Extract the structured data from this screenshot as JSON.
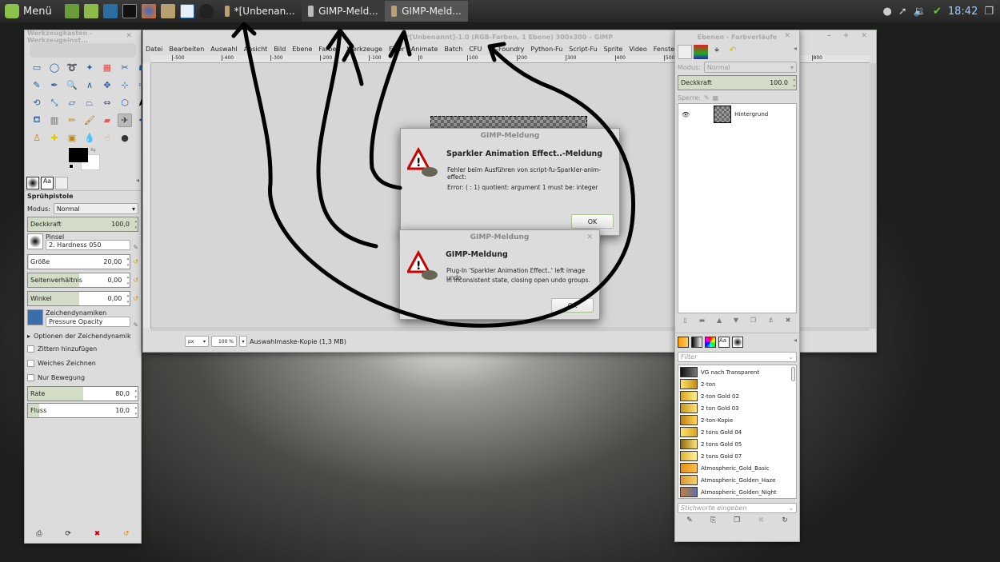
{
  "taskbar": {
    "menu_label": "Menü",
    "launchers": [
      "show-desktop-icon",
      "files-icon",
      "network-icon",
      "terminal-icon",
      "firefox-icon",
      "gimp-icon",
      "writer-icon",
      "tux-icon"
    ],
    "tasks": [
      {
        "label": "*[Unbenan...",
        "active": false
      },
      {
        "label": "GIMP-Meld...",
        "active": false
      },
      {
        "label": "GIMP-Meld...",
        "active": true
      }
    ],
    "clock": "18:42",
    "tray": [
      "user-icon",
      "network-icon",
      "volume-icon",
      "shield-check-icon",
      "windows-icon"
    ]
  },
  "toolbox": {
    "title": "Werkzeugkasten - Werkzeugeinst...",
    "tool_name": "Sprühpistole",
    "mode_label": "Modus:",
    "mode_value": "Normal",
    "opacity": {
      "label": "Deckkraft",
      "value": "100,0",
      "fraction": 1.0
    },
    "brush_label": "Pinsel",
    "brush_value": "2. Hardness 050",
    "size": {
      "label": "Größe",
      "value": "20,00",
      "fraction": 0.01
    },
    "aspect": {
      "label": "Seitenverhältnis",
      "value": "0,00",
      "fraction": 0.5
    },
    "angle": {
      "label": "Winkel",
      "value": "0,00",
      "fraction": 0.5
    },
    "dynamics_label": "Zeichendynamiken",
    "dynamics_value": "Pressure Opacity",
    "dynamics_options": "Optionen der Zeichendynamik",
    "checkboxes": [
      "Zittern hinzufügen",
      "Weiches Zeichnen",
      "Nur Bewegung"
    ],
    "rate": {
      "label": "Rate",
      "value": "80,0",
      "fraction": 0.5
    },
    "flow": {
      "label": "Fluss",
      "value": "10,0",
      "fraction": 0.1
    },
    "fg_color": "#000000",
    "bg_color": "#ffffff"
  },
  "image_window": {
    "title": "*[Unbenannt]-1.0 (RGB-Farben, 1 Ebene) 300x300 – GIMP",
    "menu": [
      "Datei",
      "Bearbeiten",
      "Auswahl",
      "Ansicht",
      "Bild",
      "Ebene",
      "Farben",
      "Werkzeuge",
      "Filter",
      "Animate",
      "Batch",
      "CFU",
      "FX-Foundry",
      "Python-Fu",
      "Script-Fu",
      "Sprite",
      "Video",
      "Fenster",
      "Hilfe"
    ],
    "ruler_labels": [
      "-500",
      "-400",
      "-300",
      "-200",
      "-100",
      "0",
      "100",
      "200",
      "300",
      "400",
      "500",
      "600",
      "700",
      "800"
    ],
    "unit": "px",
    "zoom": "100 %",
    "status": "Auswahlmaske-Kopie (1,3 MB)"
  },
  "dialog1": {
    "title": "GIMP-Meldung",
    "heading": "Sparkler Animation Effect..-Meldung",
    "line1": "Fehler beim Ausführen von script-fu-Sparkler-anim-effect:",
    "line2": "Error: ( : 1) quotient: argument 1 must be: integer",
    "ok": "OK"
  },
  "dialog2": {
    "title": "GIMP-Meldung",
    "heading": "GIMP-Meldung",
    "line1": "Plug-In 'Sparkler Animation Effect..' left image undo",
    "line2": "in inconsistent state, closing open undo groups.",
    "ok": "OK"
  },
  "layers_dock": {
    "title": "Ebenen - Farbverläufe",
    "mode_label": "Modus:",
    "mode_value": "Normal",
    "opacity": {
      "label": "Deckkraft",
      "value": "100.0"
    },
    "lock_label": "Sperre:",
    "layers": [
      {
        "name": "Hintergrund",
        "visible": true
      }
    ],
    "gradient_filter_placeholder": "Filter",
    "gradients": [
      {
        "name": "VG nach Transparent",
        "colors": [
          "#111",
          "#777"
        ]
      },
      {
        "name": "2-ton",
        "colors": [
          "#ffe36a",
          "#c58a12"
        ]
      },
      {
        "name": "2-ton Gold 02",
        "colors": [
          "#d9a21c",
          "#fff08a"
        ]
      },
      {
        "name": "2 ton Gold 03",
        "colors": [
          "#c8941a",
          "#ffe67a"
        ]
      },
      {
        "name": "2-ton-Kopie",
        "colors": [
          "#c07f10",
          "#ffd85a"
        ]
      },
      {
        "name": "2 tons Gold 04",
        "colors": [
          "#ffe36a",
          "#d9a21c"
        ]
      },
      {
        "name": "2 tons Gold 05",
        "colors": [
          "#8a6a10",
          "#ffe67a"
        ]
      },
      {
        "name": "2 tons Gold 07",
        "colors": [
          "#e0b030",
          "#fff4a0"
        ]
      },
      {
        "name": "Atmospheric_Gold_Basic",
        "colors": [
          "#e5901a",
          "#f8c048"
        ]
      },
      {
        "name": "Atmospheric_Golden_Haze",
        "colors": [
          "#d89a30",
          "#f8d070"
        ]
      },
      {
        "name": "Atmospheric_Golden_Night",
        "colors": [
          "#c08040",
          "#6070a0"
        ]
      }
    ],
    "tags_placeholder": "Stichworte eingeben"
  }
}
